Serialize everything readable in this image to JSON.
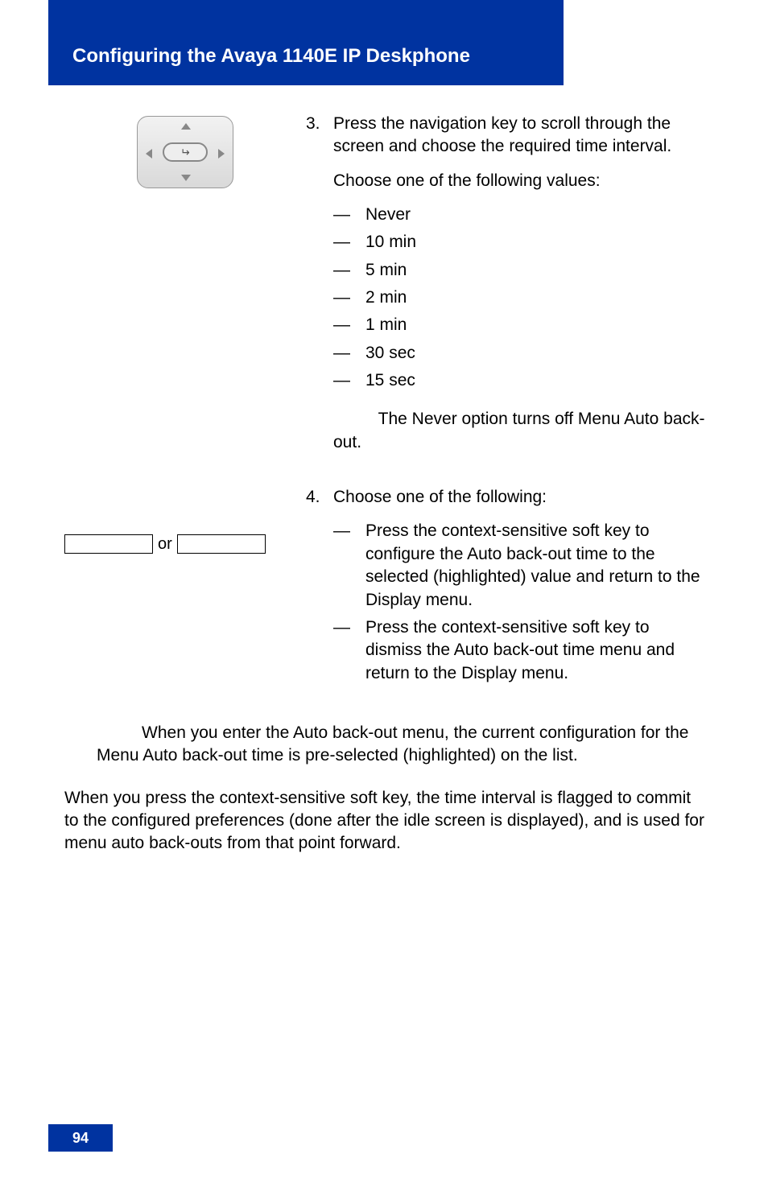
{
  "header": {
    "title": "Configuring the Avaya 1140E IP Deskphone"
  },
  "step3": {
    "number": "3.",
    "line1_a": "Press the ",
    "line1_b": " navigation key to scroll through the screen and choose the required time interval.",
    "line2": "Choose one of the following values:",
    "dash": "—",
    "options": [
      "Never",
      "10 min",
      "5 min",
      "2 min",
      "1 min",
      "30 sec",
      "15 sec"
    ],
    "note": "The Never option turns off Menu Auto back-out."
  },
  "step4": {
    "number": "4.",
    "intro": "Choose one of the following:",
    "dash": "—",
    "item1_a": "Press the ",
    "item1_b": " context-sensitive soft key to configure the Auto back-out time to the selected (highlighted) value and return to the Display menu.",
    "item2_a": "Press the ",
    "item2_b": " context-sensitive soft key to dismiss the Auto back-out time menu and return to the Display menu.",
    "or": "or"
  },
  "footnote": "When you enter the Auto back-out menu, the current configuration for the Menu Auto back-out time is pre-selected (highlighted) on the list.",
  "endpara_a": "When you press the ",
  "endpara_b": " context-sensitive soft key, the time interval is flagged to commit to the configured preferences (done after the idle screen is displayed), and is used for menu auto back-outs from that point forward.",
  "page_number": "94"
}
